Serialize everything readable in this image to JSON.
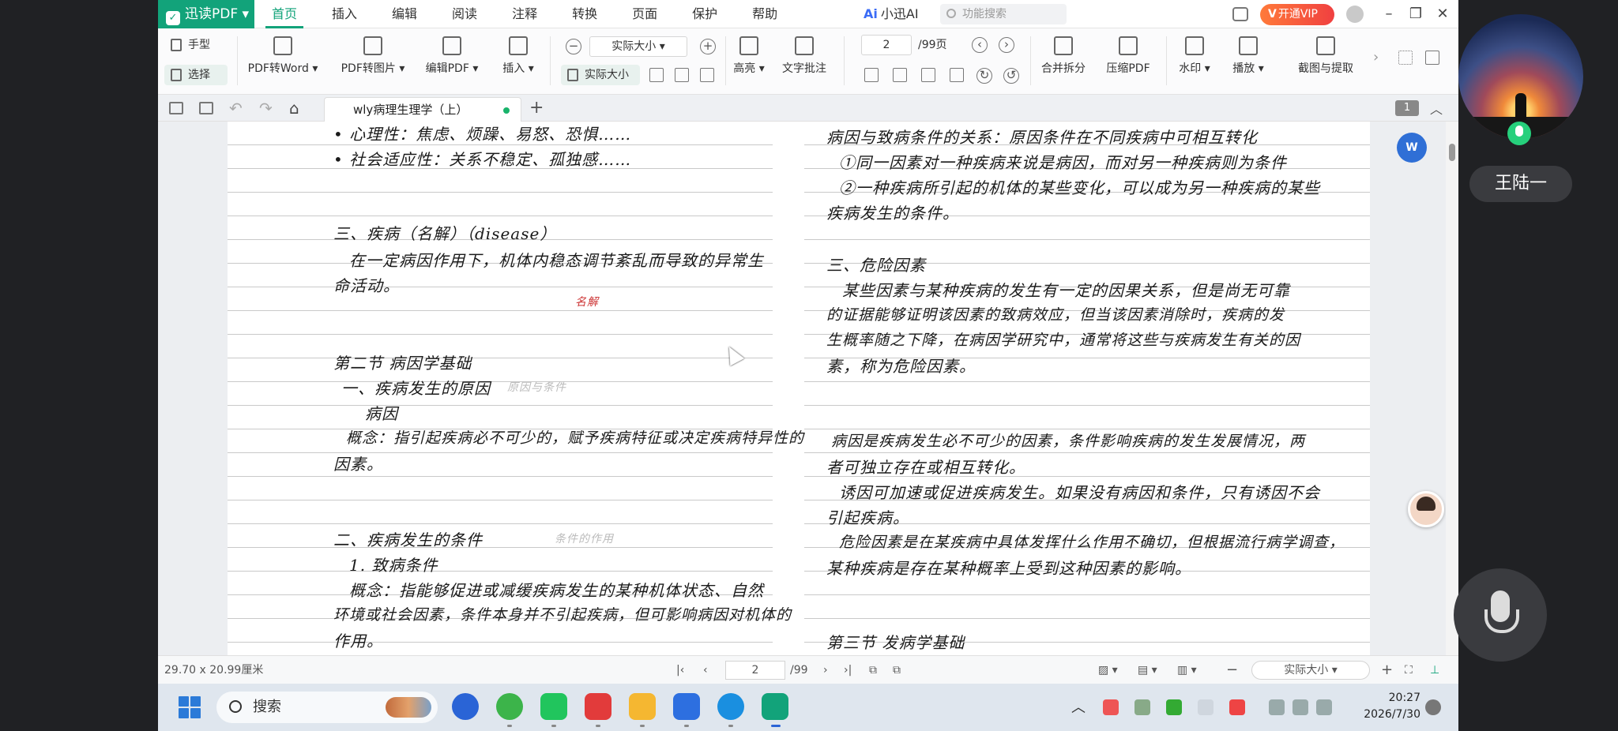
{
  "app": {
    "logo": "迅读PDF",
    "menus": [
      "首页",
      "插入",
      "编辑",
      "阅读",
      "注释",
      "转换",
      "页面",
      "保护",
      "帮助"
    ],
    "ai": "小迅AI",
    "search_placeholder": "功能搜索",
    "vip": "开通VIP"
  },
  "ribbon": {
    "hand": "手型",
    "select": "选择",
    "pdf_to_word": "PDF转Word",
    "pdf_to_image": "PDF转图片",
    "edit_pdf": "编辑PDF",
    "insert": "插入",
    "zoom_value": "实际大小",
    "actual_size": "实际大小",
    "highlight": "高亮",
    "text_note": "文字批注",
    "page_current": "2",
    "page_total": "/99页",
    "merge_split": "合并拆分",
    "compress": "压缩PDF",
    "watermark": "水印",
    "play": "播放",
    "screenshot": "截图与提取"
  },
  "tabs": {
    "doc_title": "wly病理生理学（上）",
    "page_badge": "1"
  },
  "document": {
    "left": [
      "• 心理性：焦虑、烦躁、易怒、恐惧……",
      "• 社会适应性：关系不稳定、孤独感……",
      "三、疾病（名解）（disease）",
      "在一定病因作用下，机体内稳态调节紊乱而导致的异常生",
      "命活动。",
      "第二节  病因学基础",
      "一、疾病发生的原因",
      "病因",
      "概念：指引起疾病必不可少的，赋予疾病特征或决定疾病特异性的",
      "因素。",
      "二、疾病发生的条件",
      "1. 致病条件",
      "概念：指能够促进或减缓疾病发生的某种机体状态、自然",
      "环境或社会因素，条件本身并不引起疾病，但可影响病因对机体的",
      "作用。"
    ],
    "left_faint": [
      "原因与条件",
      "条件的作用"
    ],
    "left_red": "名解",
    "right": [
      "病因与致病条件的关系：原因条件在不同疾病中可相互转化",
      "①同一因素对一种疾病来说是病因，而对另一种疾病则为条件",
      "②一种疾病所引起的机体的某些变化，可以成为另一种疾病的某些",
      "疾病发生的条件。",
      "三、危险因素",
      "某些因素与某种疾病的发生有一定的因果关系，但是尚无可靠",
      "的证据能够证明该因素的致病效应，但当该因素消除时，疾病的发",
      "生概率随之下降，在病因学研究中，通常将这些与疾病发生有关的因",
      "素，称为危险因素。",
      "病因是疾病发生必不可少的因素，条件影响疾病的发生发展情况，两",
      "者可独立存在或相互转化。",
      "诱因可加速或促进疾病发生。如果没有病因和条件，只有诱因不会",
      "引起疾病。",
      "危险因素是在某疾病中具体发挥什么作用不确切，但根据流行病学调查，",
      "某种疾病是存在某种概率上受到这种因素的影响。",
      "第三节  发病学基础"
    ]
  },
  "statusbar": {
    "page_size": "29.70 x 20.99厘米",
    "page_current": "2",
    "page_total": "/99",
    "zoom": "实际大小"
  },
  "taskbar": {
    "search": "搜索",
    "time": "20:27",
    "date": "2026/7/30"
  },
  "presenter": {
    "name": "王陆一"
  },
  "colors": {
    "brand": "#12a37a",
    "vip": "#f04040",
    "ai": "#3b6cf6"
  }
}
